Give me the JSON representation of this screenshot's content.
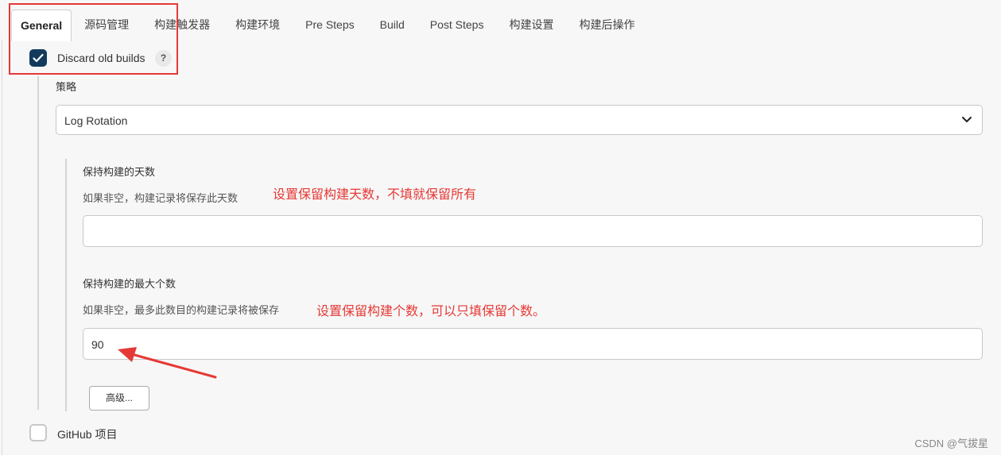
{
  "tabs": [
    {
      "label": "General",
      "active": true
    },
    {
      "label": "源码管理",
      "active": false
    },
    {
      "label": "构建触发器",
      "active": false
    },
    {
      "label": "构建环境",
      "active": false
    },
    {
      "label": "Pre Steps",
      "active": false
    },
    {
      "label": "Build",
      "active": false
    },
    {
      "label": "Post Steps",
      "active": false
    },
    {
      "label": "构建设置",
      "active": false
    },
    {
      "label": "构建后操作",
      "active": false
    }
  ],
  "discard": {
    "label": "Discard old builds",
    "checked": true,
    "help": "?"
  },
  "strategy": {
    "label": "策略",
    "value": "Log Rotation"
  },
  "days_to_keep": {
    "label": "保持构建的天数",
    "description": "如果非空，构建记录将保存此天数",
    "annotation": "设置保留构建天数，不填就保留所有",
    "value": ""
  },
  "max_builds": {
    "label": "保持构建的最大个数",
    "description": "如果非空，最多此数目的构建记录将被保存",
    "annotation": "设置保留构建个数，可以只填保留个数。",
    "value": "90"
  },
  "advanced_button": "高级...",
  "github": {
    "label": "GitHub 项目",
    "checked": false
  },
  "watermark": "CSDN @气拔星",
  "colors": {
    "annotation": "#e53935",
    "checkbox": "#123a5c"
  }
}
